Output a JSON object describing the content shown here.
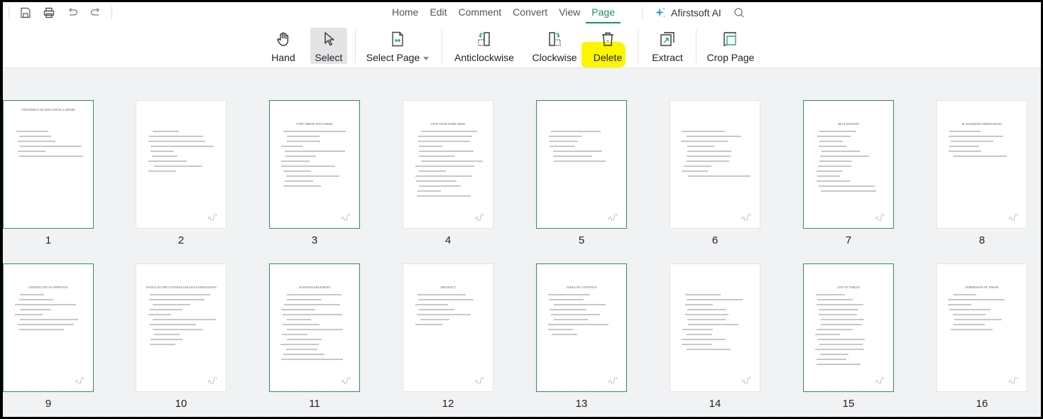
{
  "quick_access": [
    {
      "name": "save-icon"
    },
    {
      "name": "print-icon"
    },
    {
      "name": "undo-icon"
    },
    {
      "name": "redo-icon"
    }
  ],
  "menu_tabs": [
    {
      "label": "Home",
      "active": false
    },
    {
      "label": "Edit",
      "active": false
    },
    {
      "label": "Comment",
      "active": false
    },
    {
      "label": "Convert",
      "active": false
    },
    {
      "label": "View",
      "active": false
    },
    {
      "label": "Page",
      "active": true
    }
  ],
  "ai_button": {
    "label": "Afirstsoft AI",
    "icon": "sparkle-icon"
  },
  "search": {
    "icon": "search-icon"
  },
  "ribbon": {
    "hand": {
      "label": "Hand",
      "icon": "hand-icon"
    },
    "select": {
      "label": "Select",
      "icon": "cursor-icon",
      "pressed": true
    },
    "select_page": {
      "label": "Select Page",
      "icon": "select-page-icon",
      "has_dropdown": true
    },
    "anticlockwise": {
      "label": "Anticlockwise",
      "icon": "rotate-left-icon"
    },
    "clockwise": {
      "label": "Clockwise",
      "icon": "rotate-right-icon"
    },
    "delete": {
      "label": "Delete",
      "icon": "trash-icon",
      "highlighted": true
    },
    "extract": {
      "label": "Extract",
      "icon": "extract-icon"
    },
    "crop_page": {
      "label": "Crop Page",
      "icon": "crop-icon"
    }
  },
  "colors": {
    "accent": "#1a9068",
    "selected_border": "#2e8b6e",
    "highlight": "#fdf500",
    "background": "#f1f2f4"
  },
  "pages": [
    {
      "number": "1",
      "selected": true,
      "heading": "UNIVERSITY OF EDUCATION, LAHORE"
    },
    {
      "number": "2",
      "selected": false,
      "heading": ""
    },
    {
      "number": "3",
      "selected": true,
      "heading": "TYPE THESIS TITLE HERE"
    },
    {
      "number": "4",
      "selected": false,
      "heading": "TYPE YOUR NAME HERE"
    },
    {
      "number": "5",
      "selected": true,
      "heading": ""
    },
    {
      "number": "6",
      "selected": false,
      "heading": ""
    },
    {
      "number": "7",
      "selected": true,
      "heading": "DECLARATION"
    },
    {
      "number": "8",
      "selected": false,
      "heading": "PLAGIARISM UNDERTAKING"
    },
    {
      "number": "9",
      "selected": true,
      "heading": "CERTIFICATE OF APPROVAL"
    },
    {
      "number": "10",
      "selected": false,
      "heading": "OFFICE OF THE CONTROLLER OF EXAMINATIONS"
    },
    {
      "number": "11",
      "selected": true,
      "heading": "ACKNOWLEDGEMENT"
    },
    {
      "number": "12",
      "selected": false,
      "heading": "ABSTRACT"
    },
    {
      "number": "13",
      "selected": true,
      "heading": "TABLE OF CONTENTS"
    },
    {
      "number": "14",
      "selected": false,
      "heading": ""
    },
    {
      "number": "15",
      "selected": true,
      "heading": "LIST OF TABLES"
    },
    {
      "number": "16",
      "selected": false,
      "heading": "SUBMISSION OF THESIS"
    }
  ]
}
